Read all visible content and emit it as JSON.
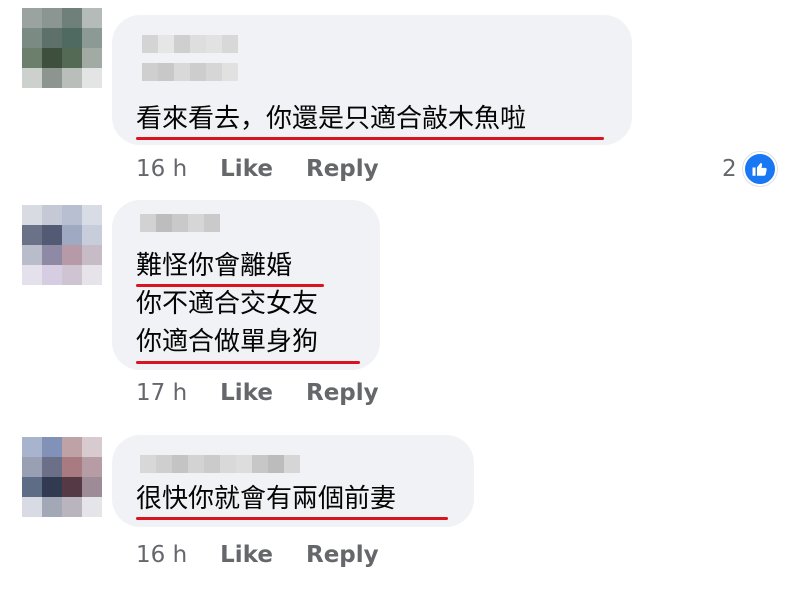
{
  "comments": [
    {
      "lines": [
        "看來看去，你還是只適合敲木魚啦"
      ],
      "time": "16 h",
      "like_label": "Like",
      "reply_label": "Reply",
      "reaction_count": "2"
    },
    {
      "lines": [
        "難怪你會離婚",
        "你不適合交女友",
        "你適合做單身狗"
      ],
      "time": "17 h",
      "like_label": "Like",
      "reply_label": "Reply"
    },
    {
      "lines": [
        "很快你就會有兩個前妻"
      ],
      "time": "16 h",
      "like_label": "Like",
      "reply_label": "Reply"
    }
  ],
  "colors": {
    "bubble": "#f0f2f5",
    "underline": "#d7141f",
    "meta_text": "#65676b",
    "like_badge": "#1877f2"
  },
  "icons": {
    "reaction": "thumbs-up-icon"
  }
}
